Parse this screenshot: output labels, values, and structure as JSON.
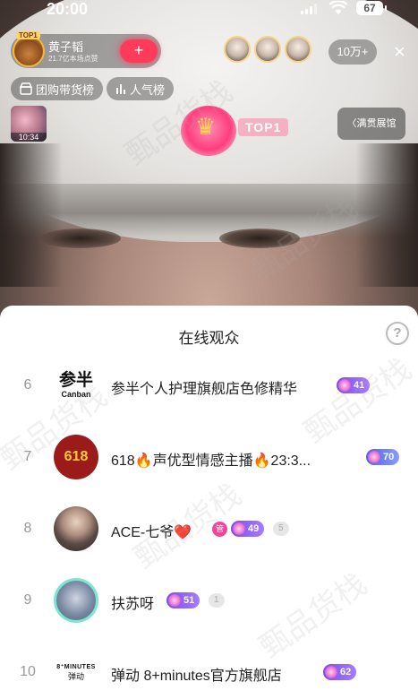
{
  "status_bar": {
    "time": "20:00",
    "battery": "67"
  },
  "live": {
    "host_name": "黄子韬",
    "host_likes": "21.7亿本场点赞",
    "top1_mini": "TOP1",
    "follow": "+",
    "viewer_count": "10万+",
    "close": "×",
    "chips": {
      "group_buy": "团购带货榜",
      "popularity": "人气榜"
    },
    "thumb_time": "10:34",
    "top1_badge": "TOP1",
    "room_link": "〈满贯展馆"
  },
  "sheet": {
    "title": "在线观众",
    "help": "?",
    "rows": [
      {
        "rank": "6",
        "avatar_big": "参半",
        "avatar_small": "Canban",
        "name": "参半个人护理旗舰店色修精华",
        "level": "41"
      },
      {
        "rank": "7",
        "avatar_text": "618",
        "name": "618🔥声优型情感主播🔥23:3...",
        "level": "70"
      },
      {
        "rank": "8",
        "name": "ACE-七爷❤️",
        "badge": "管",
        "level": "49",
        "fans": "5"
      },
      {
        "rank": "9",
        "name": "扶苏呀",
        "level": "51",
        "fans": "1"
      },
      {
        "rank": "10",
        "avatar_a": "8⁺MINUTES",
        "avatar_b": "弹动",
        "name": "弹动 8+minutes官方旗舰店",
        "level": "62"
      }
    ]
  },
  "watermark": "甄品货栈",
  "icons": [
    "signal-icon",
    "wifi-icon",
    "battery-icon",
    "close-icon",
    "storefront-icon",
    "bar-chart-icon",
    "crown-icon",
    "help-icon",
    "level-gem-icon"
  ]
}
